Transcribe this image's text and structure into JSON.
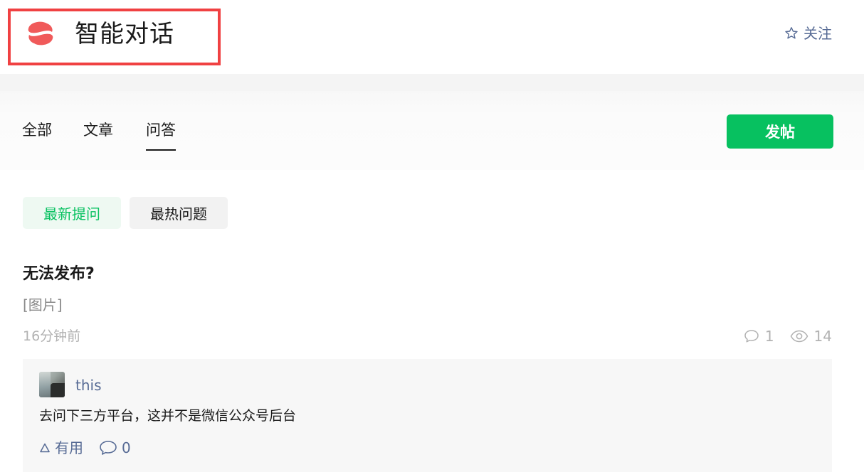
{
  "header": {
    "title": "智能对话",
    "follow_label": "关注"
  },
  "tabs": [
    {
      "label": "全部",
      "active": false
    },
    {
      "label": "文章",
      "active": false
    },
    {
      "label": "问答",
      "active": true
    }
  ],
  "post_button_label": "发帖",
  "filters": [
    {
      "label": "最新提问",
      "active": true
    },
    {
      "label": "最热问题",
      "active": false
    }
  ],
  "question": {
    "title": "无法发布?",
    "excerpt": "[图片]",
    "time": "16分钟前",
    "comments": "1",
    "views": "14"
  },
  "answer": {
    "user": "this",
    "text": "去问下三方平台，这并不是微信公众号后台",
    "useful_label": "有用",
    "comment_count": "0"
  },
  "colors": {
    "accent_green": "#07c160",
    "link_blue": "#576b95",
    "highlight_red": "#f04142",
    "logo_red": "#f05a5a"
  },
  "icons": [
    "logo-icon",
    "star-icon",
    "comment-icon",
    "eye-icon",
    "thumb-up-icon"
  ]
}
